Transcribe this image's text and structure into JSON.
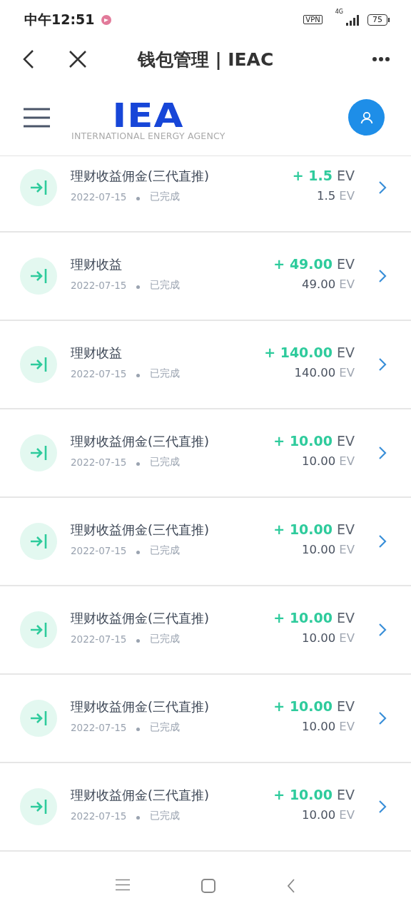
{
  "status_bar": {
    "time": "中午12:51",
    "vpn": "VPN",
    "network": "4G",
    "battery": "75"
  },
  "nav_bar": {
    "title": "钱包管理 | IEAC"
  },
  "header": {
    "logo_mark": "IEA",
    "logo_caption": "INTERNATIONAL ENERGY AGENCY"
  },
  "transactions": [
    {
      "title": "理财收益佣金(三代直推)",
      "date": "2022-07-15",
      "status": "已完成",
      "amount": "+ 1.5",
      "amount_unit": "EV",
      "balance": "1.5",
      "balance_unit": "EV"
    },
    {
      "title": "理财收益",
      "date": "2022-07-15",
      "status": "已完成",
      "amount": "+ 49.00",
      "amount_unit": "EV",
      "balance": "49.00",
      "balance_unit": "EV"
    },
    {
      "title": "理财收益",
      "date": "2022-07-15",
      "status": "已完成",
      "amount": "+ 140.00",
      "amount_unit": "EV",
      "balance": "140.00",
      "balance_unit": "EV"
    },
    {
      "title": "理财收益佣金(三代直推)",
      "date": "2022-07-15",
      "status": "已完成",
      "amount": "+ 10.00",
      "amount_unit": "EV",
      "balance": "10.00",
      "balance_unit": "EV"
    },
    {
      "title": "理财收益佣金(三代直推)",
      "date": "2022-07-15",
      "status": "已完成",
      "amount": "+ 10.00",
      "amount_unit": "EV",
      "balance": "10.00",
      "balance_unit": "EV"
    },
    {
      "title": "理财收益佣金(三代直推)",
      "date": "2022-07-15",
      "status": "已完成",
      "amount": "+ 10.00",
      "amount_unit": "EV",
      "balance": "10.00",
      "balance_unit": "EV"
    },
    {
      "title": "理财收益佣金(三代直推)",
      "date": "2022-07-15",
      "status": "已完成",
      "amount": "+ 10.00",
      "amount_unit": "EV",
      "balance": "10.00",
      "balance_unit": "EV"
    },
    {
      "title": "理财收益佣金(三代直推)",
      "date": "2022-07-15",
      "status": "已完成",
      "amount": "+ 10.00",
      "amount_unit": "EV",
      "balance": "10.00",
      "balance_unit": "EV"
    }
  ]
}
